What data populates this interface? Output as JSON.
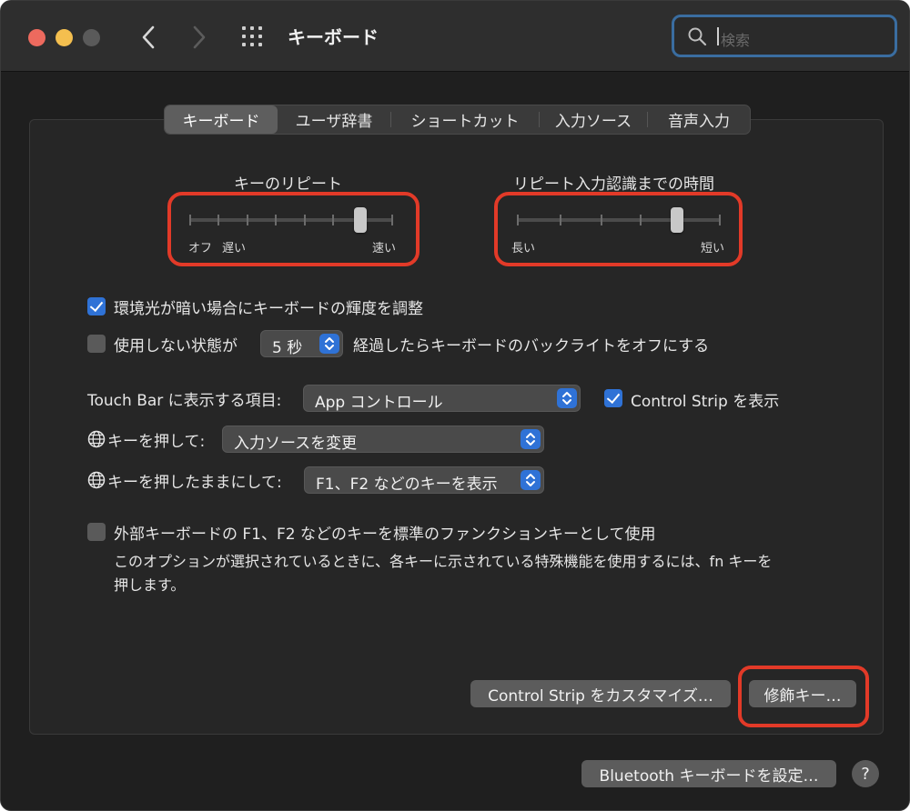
{
  "window": {
    "title": "キーボード"
  },
  "search": {
    "placeholder": "検索"
  },
  "tabs": [
    {
      "label": "キーボード",
      "active": true
    },
    {
      "label": "ユーザ辞書",
      "active": false
    },
    {
      "label": "ショートカット",
      "active": false
    },
    {
      "label": "入力ソース",
      "active": false
    },
    {
      "label": "音声入力",
      "active": false
    }
  ],
  "key_repeat": {
    "title": "キーのリピート",
    "label_off": "オフ",
    "label_slow": "遅い",
    "label_fast": "速い",
    "value_fraction": 0.8
  },
  "delay_until_repeat": {
    "title": "リピート入力認識までの時間",
    "label_long": "長い",
    "label_short": "短い",
    "value_fraction": 0.8
  },
  "options": {
    "ambient_light": {
      "label": "環境光が暗い場合にキーボードの輝度を調整",
      "checked": true
    },
    "backlight_off": {
      "prefix": "使用しない状態が",
      "value": "5 秒",
      "suffix": "経過したらキーボードのバックライトをオフにする",
      "checked": false
    }
  },
  "touchbar": {
    "label": "Touch Bar に表示する項目:",
    "value": "App コントロール",
    "control_strip_label": "Control Strip を表示",
    "control_strip_checked": true
  },
  "globe_press": {
    "label": "キーを押して:",
    "value": "入力ソースを変更"
  },
  "globe_hold": {
    "label": "キーを押したままにして:",
    "value": "F1、F2 などのキーを表示"
  },
  "fn_keys": {
    "label": "外部キーボードの F1、F2 などのキーを標準のファンクションキーとして使用",
    "description_line1": "このオプションが選択されているときに、各キーに示されている特殊機能を使用するには、fn キーを",
    "description_line2": "押します。",
    "checked": false
  },
  "buttons": {
    "customize_control_strip": "Control Strip をカスタマイズ…",
    "modifier_keys": "修飾キー…",
    "bluetooth_keyboard": "Bluetooth キーボードを設定…",
    "help": "?"
  },
  "colors": {
    "accent": "#2f72d6",
    "highlight_red": "#e23a28",
    "search_border": "#3a6da0"
  }
}
